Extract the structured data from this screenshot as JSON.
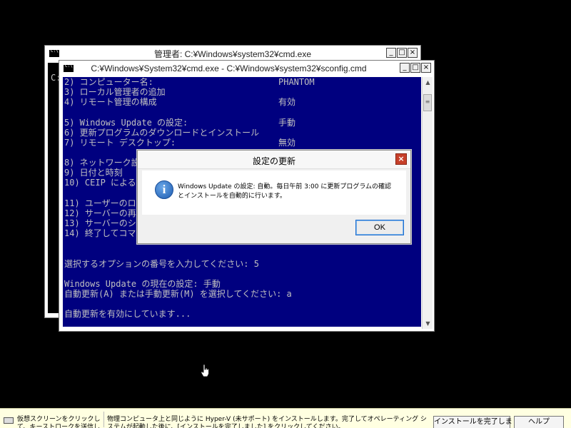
{
  "back_window": {
    "title": "管理者: C:¥Windows¥system32¥cmd.exe",
    "peek_text": "C:"
  },
  "front_window": {
    "title": "C:¥Windows¥System32¥cmd.exe - C:¥Windows¥system32¥sconfig.cmd",
    "lines": [
      {
        "text": "2) コンピューター名:",
        "value": "PHANTOM"
      },
      {
        "text": "3) ローカル管理者の追加",
        "value": ""
      },
      {
        "text": "4) リモート管理の構成",
        "value": "有効"
      },
      {
        "text": "",
        "value": ""
      },
      {
        "text": "5) Windows Update の設定:",
        "value": "手動"
      },
      {
        "text": "6) 更新プログラムのダウンロードとインストール",
        "value": ""
      },
      {
        "text": "7) リモート デスクトップ:",
        "value": "無効"
      },
      {
        "text": "",
        "value": ""
      },
      {
        "text": "8) ネットワーク設",
        "value": ""
      },
      {
        "text": "9) 日付と時刻",
        "value": ""
      },
      {
        "text": "10) CEIP による製",
        "value": ""
      },
      {
        "text": "",
        "value": ""
      },
      {
        "text": "11) ユーザーのロ",
        "value": ""
      },
      {
        "text": "12) サーバーの再起",
        "value": ""
      },
      {
        "text": "13) サーバーのシ",
        "value": ""
      },
      {
        "text": "14) 終了してコマ",
        "value": ""
      },
      {
        "text": "",
        "value": ""
      },
      {
        "text": "",
        "value": ""
      },
      {
        "text": "選択するオプションの番号を入力してください: 5",
        "value": ""
      },
      {
        "text": "",
        "value": ""
      },
      {
        "text": "Windows Update の現在の設定: 手動",
        "value": ""
      },
      {
        "text": "自動更新(A) または手動更新(M) を選択してください: a",
        "value": ""
      },
      {
        "text": "",
        "value": ""
      },
      {
        "text": "自動更新を有効にしています...",
        "value": ""
      }
    ]
  },
  "window_controls": {
    "minimize": "_",
    "maximize": "□",
    "close": "×"
  },
  "dialog": {
    "title": "設定の更新",
    "close": "×",
    "icon": "i",
    "message_line1": "Windows Update の設定: 自動。毎日午前 3:00 に更新プログラムの確認",
    "message_line2": "とインストールを自動的に行います。",
    "ok_label": "OK"
  },
  "infobar": {
    "left_text": "仮想スクリーンをクリックして、キーストロークを送信します",
    "main_text": "物理コンピュータ上と同じように Hyper-V (未サポート) をインストールします。完了してオペレーティング システムが起動した後に、[インストールを完了しました] をクリックしてください。",
    "done_button": "インストールを完了しました",
    "help_button": "ヘルプ"
  }
}
